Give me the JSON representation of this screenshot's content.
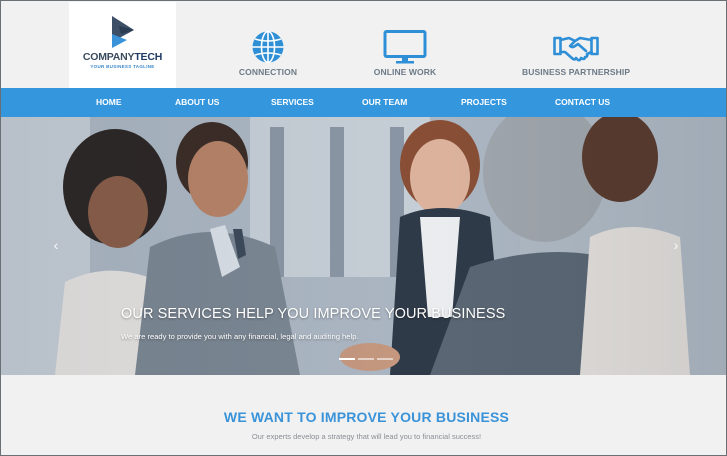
{
  "brand": {
    "name_part1": "COMPANY",
    "name_part2": "TECH",
    "tagline": "YOUR BUSINESS TAGLINE"
  },
  "features": [
    {
      "label": "CONNECTION",
      "icon": "globe-icon"
    },
    {
      "label": "ONLINE WORK",
      "icon": "monitor-icon"
    },
    {
      "label": "BUSINESS PARTNERSHIP",
      "icon": "handshake-icon"
    }
  ],
  "nav": {
    "items": [
      {
        "label": "HOME"
      },
      {
        "label": "ABOUT US"
      },
      {
        "label": "SERVICES"
      },
      {
        "label": "OUR TEAM"
      },
      {
        "label": "PROJECTS"
      },
      {
        "label": "CONTACT US"
      }
    ]
  },
  "hero": {
    "title": "OUR SERVICES HELP YOU IMPROVE YOUR BUSINESS",
    "subtitle": "We are ready to provide you with any financial, legal and auditing help.",
    "prev_icon": "chevron-left-icon",
    "next_icon": "chevron-right-icon",
    "prev_glyph": "‹",
    "next_glyph": "›",
    "slides_count": 3,
    "active_slide": 1
  },
  "section": {
    "title": "WE WANT TO IMPROVE YOUR BUSINESS",
    "subtitle": "Our experts develop a strategy that will lead you to financial success!"
  },
  "colors": {
    "accent": "#3497de",
    "heading": "#3a93d8",
    "logo_dark": "#1f3b63"
  }
}
